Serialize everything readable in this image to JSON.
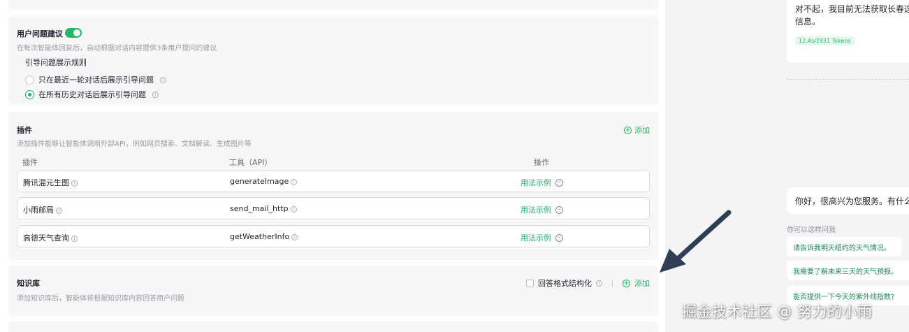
{
  "suggestion": {
    "title": "用户问题建议",
    "toggle_on": true,
    "desc": "在每次智能体回复后，自动根据对话内容提供3条用户提问的建议",
    "rule_title": "引导问题展示规则",
    "options": [
      {
        "label": "只在最近一轮对话后展示引导问题",
        "selected": false
      },
      {
        "label": "在所有历史对话后展示引导问题",
        "selected": true
      }
    ]
  },
  "plugins": {
    "title": "插件",
    "desc": "添加插件能够让智能体调用外部API，例如网页搜索、文档解读、生成图片等",
    "add_label": "添加",
    "columns": [
      "插件",
      "工具（API）",
      "操作"
    ],
    "rows": [
      {
        "name": "腾讯混元生图",
        "tool": "generateImage",
        "action": "用法示例"
      },
      {
        "name": "小雨邮局",
        "tool": "send_mail_http",
        "action": "用法示例"
      },
      {
        "name": "高德天气查询",
        "tool": "getWeatherInfo",
        "action": "用法示例"
      }
    ]
  },
  "knowledge": {
    "title": "知识库",
    "desc": "添加知识库后，智能体将根据知识库内容回答用户问题",
    "structured_label": "回答格式结构化",
    "add_label": "添加"
  },
  "preview": {
    "reply1": "对不起，我目前无法获取长春这信息。",
    "tokens": "12.4s/1931 Tokens",
    "reply2": "你好，很高兴为您服务。有什么",
    "ask_label": "你可以这样问我",
    "suggestions": [
      "请告诉我明天纽约的天气情况。",
      "我需要了解未来三天的天气预报。",
      "能否提供一下今天的紫外线指数?"
    ]
  },
  "watermark": "掘金技术社区 @ 努力的小雨",
  "colors": {
    "accent": "#27b36a",
    "annotation_arrow": "#2f3e55"
  }
}
